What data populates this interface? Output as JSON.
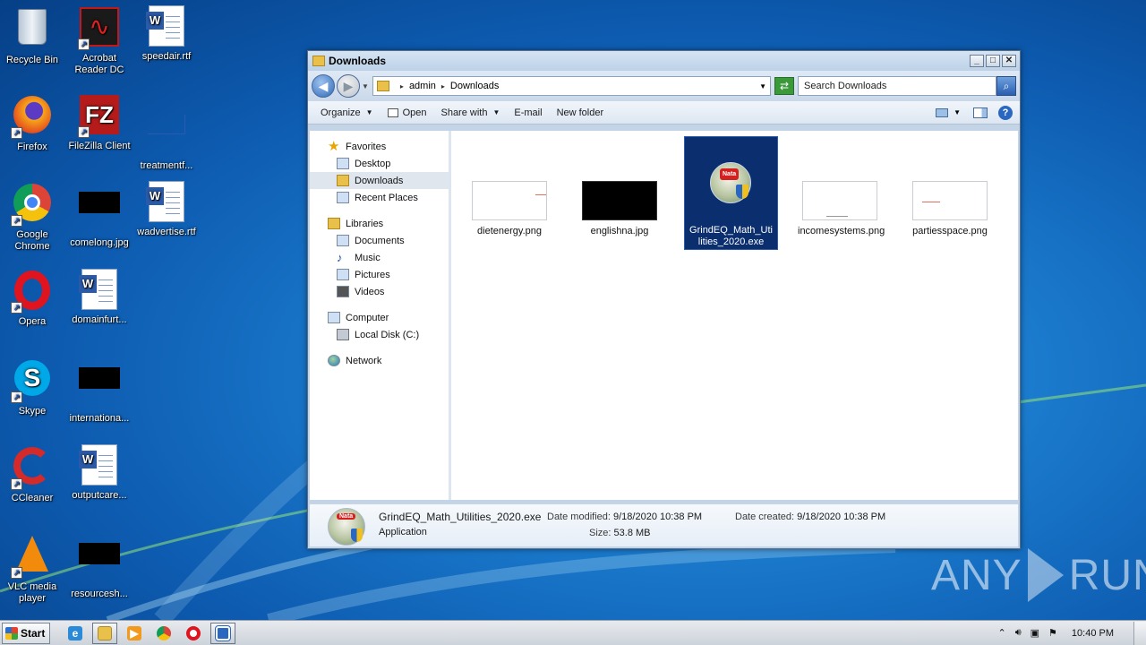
{
  "desktop": {
    "icons": [
      {
        "label": "Recycle Bin"
      },
      {
        "label": "Acrobat Reader DC"
      },
      {
        "label": "speedair.rtf"
      },
      {
        "label": "Firefox"
      },
      {
        "label": "FileZilla Client"
      },
      {
        "label": "treatmentf..."
      },
      {
        "label": "Google Chrome"
      },
      {
        "label": "comelong.jpg"
      },
      {
        "label": "wadvertise.rtf"
      },
      {
        "label": "Opera"
      },
      {
        "label": "domainfurt..."
      },
      {
        "label": "Skype"
      },
      {
        "label": "internationa..."
      },
      {
        "label": "CCleaner"
      },
      {
        "label": "outputcare..."
      },
      {
        "label": "VLC media player"
      },
      {
        "label": "resourcesh..."
      }
    ]
  },
  "window": {
    "title": "Downloads",
    "controls": {
      "minimize": "_",
      "maximize": "□",
      "close": "✕"
    },
    "breadcrumb": [
      "admin",
      "Downloads"
    ],
    "search_placeholder": "Search Downloads",
    "toolbar": {
      "organize": "Organize",
      "open": "Open",
      "share_with": "Share with",
      "email": "E-mail",
      "new_folder": "New folder",
      "help": "?"
    },
    "nav": {
      "favorites": "Favorites",
      "desktop": "Desktop",
      "downloads": "Downloads",
      "recent_places": "Recent Places",
      "libraries": "Libraries",
      "documents": "Documents",
      "music": "Music",
      "pictures": "Pictures",
      "videos": "Videos",
      "computer": "Computer",
      "local_disk": "Local Disk (C:)",
      "network": "Network"
    },
    "files": [
      {
        "name": "dietenergy.png"
      },
      {
        "name": "englishna.jpg"
      },
      {
        "name": "GrindEQ_Math_Utilities_2020.exe"
      },
      {
        "name": "incomesystems.png"
      },
      {
        "name": "partiesspace.png"
      }
    ],
    "details": {
      "name": "GrindEQ_Math_Utilities_2020.exe",
      "type": "Application",
      "modified_label": "Date modified:",
      "modified_value": "9/18/2020 10:38 PM",
      "created_label": "Date created:",
      "created_value": "9/18/2020 10:38 PM",
      "size_label": "Size:",
      "size_value": "53.8 MB",
      "badge": "Nata"
    }
  },
  "taskbar": {
    "start_label": "Start",
    "clock": "10:40 PM"
  },
  "watermark": {
    "left": "ANY",
    "right": "RUN"
  }
}
